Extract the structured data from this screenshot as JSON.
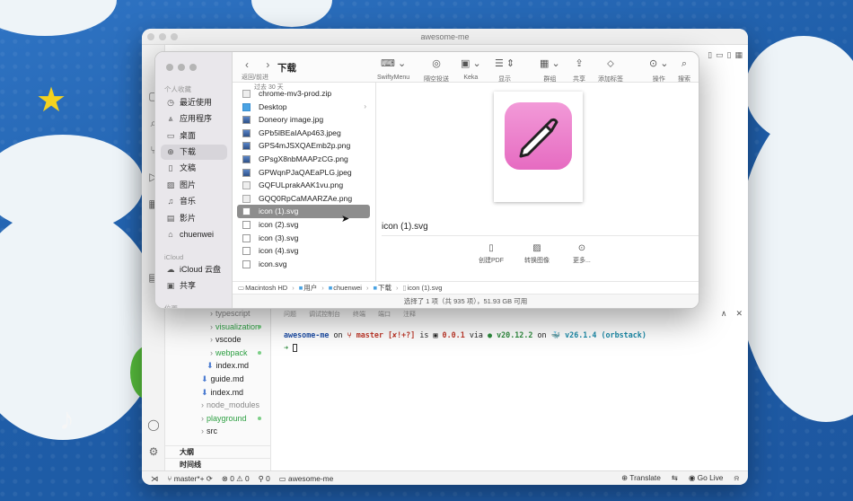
{
  "colors": {
    "accent": "#4aa3e3",
    "selection": "#8d8d8d",
    "icon_pink": "#ec7fcc",
    "git_green": "#2ea043"
  },
  "vscode": {
    "title": "awesome-me",
    "tree": [
      {
        "label": "typescript",
        "chev": "›",
        "color": "gray",
        "dot": false
      },
      {
        "label": "visualization",
        "chev": "›",
        "color": "green",
        "dot": true
      },
      {
        "label": "vscode",
        "chev": "›",
        "color": "normal",
        "dot": false
      },
      {
        "label": "webpack",
        "chev": "›",
        "color": "green",
        "dot": true
      },
      {
        "label": "index.md",
        "chev": "",
        "color": "normal",
        "dot": false
      },
      {
        "label": "guide.md",
        "chev": "",
        "color": "normal",
        "dot": false
      },
      {
        "label": "index.md",
        "chev": "",
        "color": "normal",
        "dot": false
      },
      {
        "label": "node_modules",
        "chev": "›",
        "color": "gray",
        "dot": false
      },
      {
        "label": "playground",
        "chev": "›",
        "color": "green",
        "dot": true
      },
      {
        "label": "src",
        "chev": "›",
        "color": "normal",
        "dot": false
      }
    ],
    "outline_label": "大纲",
    "timeline_label": "时间线",
    "terminal": {
      "dir": "awesome-me",
      "on": "on",
      "branch": "master",
      "flags": "[✘!+?]",
      "is": "is",
      "pkg": "0.0.1",
      "via": "via",
      "node": "v20.12.2",
      "on2": "on",
      "docker": "v26.1.4 (orbstack)",
      "prompt": "➜"
    },
    "status": {
      "branch": "master*+",
      "problems": "⊗ 0 ⚠ 0",
      "ports": "⚲ 0",
      "folder": "awesome-me",
      "translate": "Translate",
      "golive": "Go Live"
    }
  },
  "finder": {
    "title": "下载",
    "nav_label": "返回/前进",
    "sidebar": {
      "section_favorites": "个人收藏",
      "section_icloud": "iCloud",
      "section_locations": "位置",
      "items": [
        {
          "label": "最近使用",
          "icon": "clock-icon",
          "glyph": "◷"
        },
        {
          "label": "应用程序",
          "icon": "apps-icon",
          "glyph": "⩓"
        },
        {
          "label": "桌面",
          "icon": "desktop-icon",
          "glyph": "▭"
        },
        {
          "label": "下载",
          "icon": "download-icon",
          "glyph": "⊕"
        },
        {
          "label": "文稿",
          "icon": "document-icon",
          "glyph": "▯"
        },
        {
          "label": "图片",
          "icon": "picture-icon",
          "glyph": "▨"
        },
        {
          "label": "音乐",
          "icon": "music-icon",
          "glyph": "♫"
        },
        {
          "label": "影片",
          "icon": "film-icon",
          "glyph": "▤"
        },
        {
          "label": "chuenwei",
          "icon": "home-icon",
          "glyph": "⌂"
        },
        {
          "label": "iCloud 云盘",
          "icon": "cloud-icon",
          "glyph": "☁"
        },
        {
          "label": "共享",
          "icon": "shared-icon",
          "glyph": "▣"
        }
      ]
    },
    "toolbar": {
      "swiftymenu": "SwiftyMenu",
      "airdrop": "隔空投送",
      "keka": "Keka",
      "view": "显示",
      "group": "群组",
      "share": "共享",
      "tag": "添加标签",
      "action": "操作",
      "search": "搜索"
    },
    "list_header": "过去 30 天",
    "files": [
      {
        "name": "chrome-mv3-prod.zip",
        "kind": "doc"
      },
      {
        "name": "Desktop",
        "kind": "dir"
      },
      {
        "name": "Doneory image.jpg",
        "kind": "img"
      },
      {
        "name": "GPb5lBEaIAAp463.jpeg",
        "kind": "img"
      },
      {
        "name": "GPS4mJSXQAEmb2p.png",
        "kind": "img"
      },
      {
        "name": "GPsgX8nbMAAPzCG.png",
        "kind": "img"
      },
      {
        "name": "GPWqnPJaQAEaPLG.jpeg",
        "kind": "img"
      },
      {
        "name": "GQFULprakAAK1vu.png",
        "kind": "doc"
      },
      {
        "name": "GQQ0RpCaMAARZAe.png",
        "kind": "doc"
      },
      {
        "name": "icon (1).svg",
        "kind": "svg"
      },
      {
        "name": "icon (2).svg",
        "kind": "svg"
      },
      {
        "name": "icon (3).svg",
        "kind": "svg"
      },
      {
        "name": "icon (4).svg",
        "kind": "svg"
      },
      {
        "name": "icon.svg",
        "kind": "svg"
      }
    ],
    "preview": {
      "name": "icon (1).svg",
      "create_pdf": "创建PDF",
      "convert_image": "转换图像",
      "more": "更多..."
    },
    "path": [
      "Macintosh HD",
      "用户",
      "chuenwei",
      "下载",
      "icon (1).svg"
    ],
    "status": "选择了 1 项（共 935 项），51.93 GB 可用"
  }
}
